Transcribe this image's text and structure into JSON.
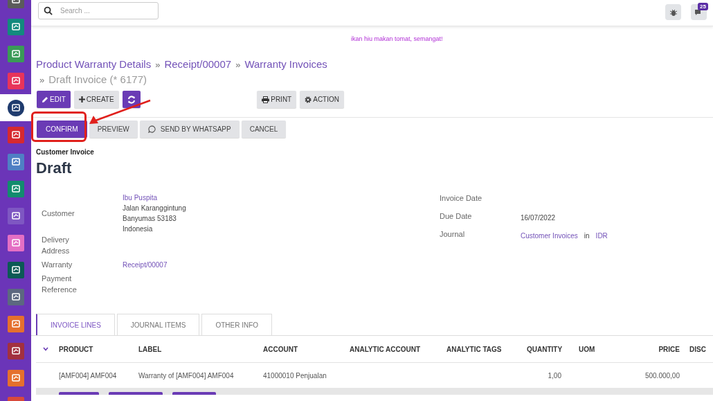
{
  "sidebar": {
    "apps": [
      {
        "color": "#5b5b5b",
        "selected": false
      },
      {
        "color": "#138a7e",
        "selected": false
      },
      {
        "color": "#3a9a57",
        "selected": false
      },
      {
        "color": "#e8345a",
        "selected": false
      },
      {
        "color": "#1f3b6e",
        "selected": true
      },
      {
        "color": "#d6292f",
        "selected": false
      },
      {
        "color": "#4f7fc4",
        "selected": false
      },
      {
        "color": "#128c6e",
        "selected": false
      },
      {
        "color": "#7e57c2",
        "selected": false
      },
      {
        "color": "#e46fc4",
        "selected": false
      },
      {
        "color": "#0c5a55",
        "selected": false
      },
      {
        "color": "#5c6880",
        "selected": false
      },
      {
        "color": "#e5702d",
        "selected": false
      },
      {
        "color": "#a2303f",
        "selected": false
      },
      {
        "color": "#e5702d",
        "selected": false
      },
      {
        "color": "#d84a3b",
        "selected": false
      }
    ]
  },
  "search": {
    "placeholder": "Search ..."
  },
  "topbar": {
    "message_count": "25"
  },
  "notice": "ikan hiu makan tomat, semangat!",
  "breadcrumb": {
    "separator": "»",
    "items": [
      {
        "label": "Product Warranty Details",
        "current": false
      },
      {
        "label": "Receipt/00007",
        "current": false
      },
      {
        "label": "Warranty Invoices",
        "current": false
      },
      {
        "label": "Draft Invoice (* 6177)",
        "current": true
      }
    ]
  },
  "toolbar": [
    {
      "kind": "edit",
      "label": "EDIT",
      "primary": true
    },
    {
      "kind": "create",
      "label": "CREATE",
      "primary": false
    },
    {
      "kind": "refresh",
      "primary": true
    },
    {
      "kind": "print",
      "label": "PRINT",
      "primary": false
    },
    {
      "kind": "action",
      "label": "ACTION",
      "primary": false
    }
  ],
  "status_actions": [
    {
      "kind": "plain",
      "label": "CONFIRM",
      "primary": true
    },
    {
      "kind": "plain",
      "label": "PREVIEW",
      "primary": false
    },
    {
      "kind": "whatsapp",
      "label": "SEND BY WHATSAPP",
      "primary": false
    },
    {
      "kind": "plain",
      "label": "CANCEL",
      "primary": false
    }
  ],
  "document": {
    "type": "Customer Invoice",
    "status": "Draft"
  },
  "fields_left": [
    {
      "label": "Customer",
      "link": "Ibu Puspita",
      "lines": [
        "Jalan Karanggintung",
        "Banyumas 53183",
        "Indonesia"
      ]
    },
    {
      "label": "Delivery Address"
    },
    {
      "label": "Warranty",
      "link": "Receipt/00007"
    },
    {
      "label": "Payment Reference"
    }
  ],
  "fields_right": [
    {
      "label": "Invoice Date"
    },
    {
      "label": "Due Date",
      "value": "16/07/2022"
    },
    {
      "label": "Journal",
      "link": "Customer Invoices",
      "joiner": "in",
      "link2": "IDR"
    }
  ],
  "tabs": [
    {
      "label": "INVOICE LINES",
      "selected": true
    },
    {
      "label": "JOURNAL ITEMS",
      "selected": false
    },
    {
      "label": "OTHER INFO",
      "selected": false
    }
  ],
  "table": {
    "columns": [
      "PRODUCT",
      "LABEL",
      "ACCOUNT",
      "ANALYTIC ACCOUNT",
      "ANALYTIC TAGS",
      "QUANTITY",
      "UOM",
      "PRICE",
      "DISC"
    ],
    "rows": [
      {
        "cells": [
          "[AMF004] AMF004",
          "Warranty of [AMF004] AMF004",
          "41000010 Penjualan",
          "",
          "",
          "1,00",
          "",
          "500.000,00",
          ""
        ]
      }
    ]
  }
}
